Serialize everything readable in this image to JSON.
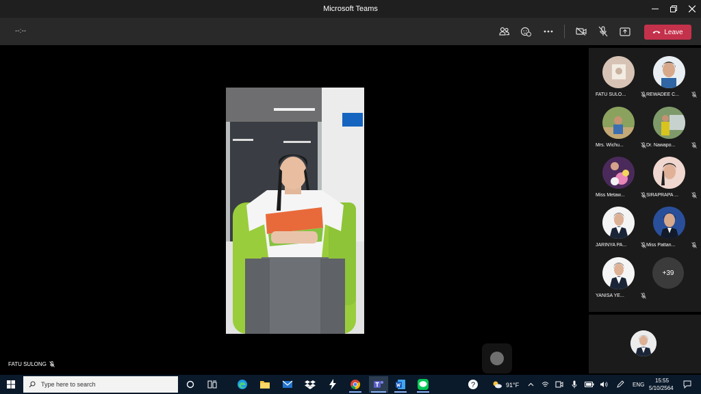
{
  "window": {
    "title": "Microsoft Teams"
  },
  "toolbar": {
    "timer": "--:--",
    "leave_label": "Leave"
  },
  "stage": {
    "speaker_name": "FATU SULONG"
  },
  "participants": [
    {
      "name": "FATU SULO..."
    },
    {
      "name": "REWADEE C..."
    },
    {
      "name": "Mrs. Wichu..."
    },
    {
      "name": "Dr. Nawapo..."
    },
    {
      "name": "Miss Metaw..."
    },
    {
      "name": "SIRAPRAPA ..."
    },
    {
      "name": "JARINYA PA..."
    },
    {
      "name": "Miss Pattan..."
    },
    {
      "name": "YANISA YE..."
    }
  ],
  "more_participants": "+39",
  "taskbar": {
    "search_placeholder": "Type here to search",
    "weather": "91°F",
    "language": "ENG",
    "time": "15:55",
    "date": "5/10/2564"
  },
  "colors": {
    "leave": "#c4314b",
    "toolbar": "#292929",
    "taskbar": "#0b1a2b"
  }
}
